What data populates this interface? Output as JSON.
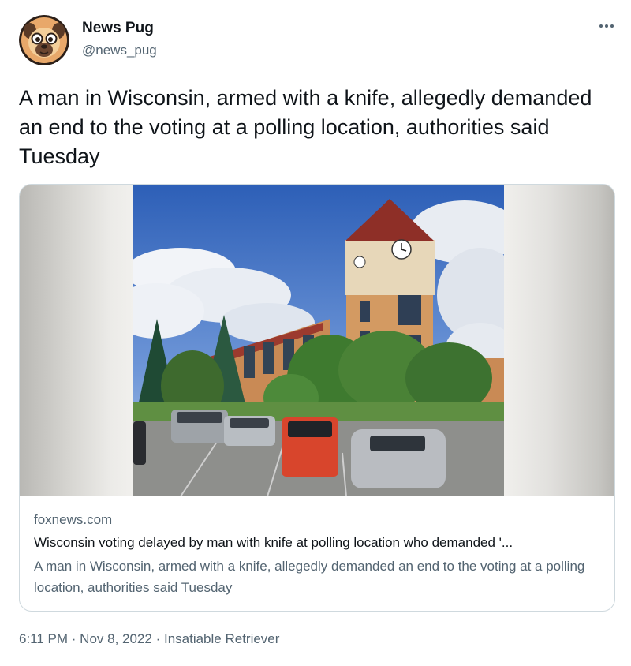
{
  "author": {
    "display_name": "News Pug",
    "handle": "@news_pug"
  },
  "icons": {
    "avatar": "pug-avatar-icon",
    "more": "more-options-icon"
  },
  "tweet": {
    "text": "A man in Wisconsin, armed with a knife, allegedly demanded an end to the voting at a polling location, authorities said Tuesday"
  },
  "card": {
    "domain": "foxnews.com",
    "title": "Wisconsin voting delayed by man with knife at polling location who demanded '...",
    "description": "A man in Wisconsin, armed with a knife, allegedly demanded an end to the voting at a polling location, authorities said Tuesday"
  },
  "meta": {
    "time": "6:11 PM",
    "separator_1": " · ",
    "date": "Nov 8, 2022",
    "separator_2": " · ",
    "source": "Insatiable Retriever"
  },
  "colors": {
    "text_primary": "#0f1419",
    "text_secondary": "#536471",
    "border": "#cfd9de"
  }
}
